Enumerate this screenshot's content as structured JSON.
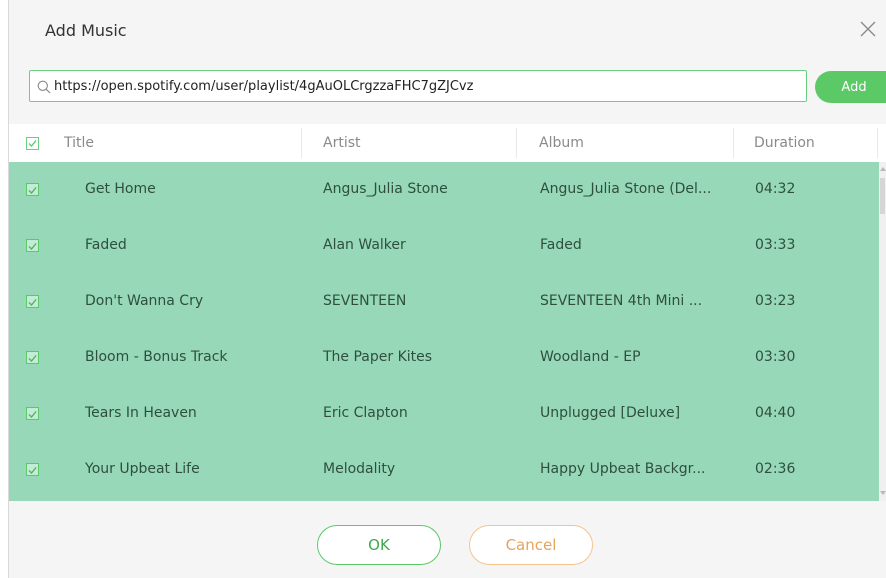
{
  "dialog": {
    "title": "Add Music",
    "close_icon": "close-icon"
  },
  "url_bar": {
    "value": "https://open.spotify.com/user/playlist/4gAuOLCrgzzaFHC7gZJCvz",
    "search_icon": "search-icon",
    "add_label": "Add"
  },
  "table": {
    "headers": {
      "title": "Title",
      "artist": "Artist",
      "album": "Album",
      "duration": "Duration"
    },
    "rows": [
      {
        "title": "Get Home",
        "artist": "Angus_Julia Stone",
        "album": "Angus_Julia Stone (Del...",
        "duration": "04:32"
      },
      {
        "title": "Faded",
        "artist": "Alan Walker",
        "album": "Faded",
        "duration": "03:33"
      },
      {
        "title": "Don't Wanna Cry",
        "artist": "SEVENTEEN",
        "album": "SEVENTEEN 4th Mini ...",
        "duration": "03:23"
      },
      {
        "title": "Bloom - Bonus Track",
        "artist": "The Paper Kites",
        "album": "Woodland - EP",
        "duration": "03:30"
      },
      {
        "title": "Tears In Heaven",
        "artist": "Eric Clapton",
        "album": "Unplugged [Deluxe]",
        "duration": "04:40"
      },
      {
        "title": "Your Upbeat Life",
        "artist": "Melodality",
        "album": "Happy Upbeat Backgr...",
        "duration": "02:36"
      }
    ]
  },
  "footer": {
    "ok_label": "OK",
    "cancel_label": "Cancel"
  },
  "colors": {
    "accent_green": "#5cc967",
    "row_selected_bg": "#96d8b8",
    "cancel_orange": "#e8a35b"
  }
}
